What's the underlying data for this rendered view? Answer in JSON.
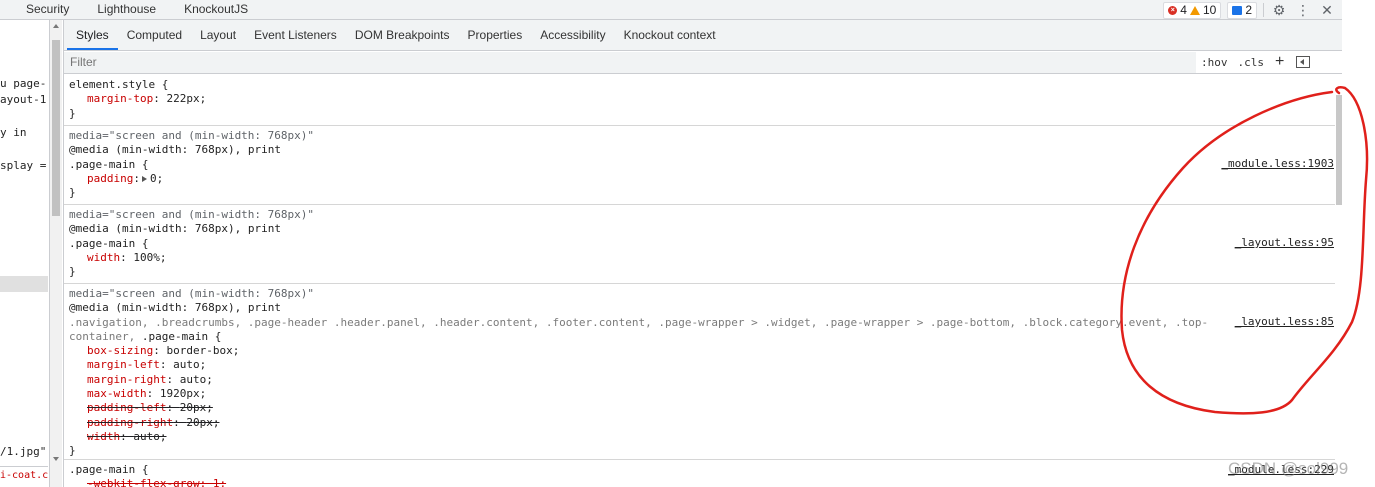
{
  "topbar": {
    "tabs": [
      "Security",
      "Lighthouse",
      "KnockoutJS"
    ],
    "errors": "4",
    "warnings": "10",
    "messages": "2",
    "icons": [
      "settings-icon",
      "more-vertical-icon",
      "close-icon"
    ],
    "close_glyph": "✕"
  },
  "left_panel": {
    "lines": [
      "u page-",
      "ayout-1",
      "y in",
      "splay ="
    ],
    "bottom_line": "/1.jpg\"",
    "bottom_file": "i-coat.c"
  },
  "styles_panel": {
    "tabs": [
      "Styles",
      "Computed",
      "Layout",
      "Event Listeners",
      "DOM Breakpoints",
      "Properties",
      "Accessibility",
      "Knockout context"
    ],
    "active_tab": "Styles",
    "filter_placeholder": "Filter",
    "hov": ":hov",
    "cls": ".cls",
    "plus": "+"
  },
  "rules": {
    "r0": {
      "selector": "element.style {",
      "decls": [
        {
          "prop": "margin-top",
          "val": "222px;"
        }
      ],
      "close": "}"
    },
    "r1": {
      "media_comment": "media=\"screen and (min-width: 768px)\"",
      "at_keyword": "@media",
      "at_query": " (min-width: 768px), print",
      "selector": ".page-main {",
      "source": "_module.less:1903",
      "decls": [
        {
          "prop": "padding",
          "val": "0;"
        }
      ],
      "close": "}"
    },
    "r2": {
      "media_comment": "media=\"screen and (min-width: 768px)\"",
      "at_keyword": "@media",
      "at_query": " (min-width: 768px), print",
      "selector": ".page-main {",
      "source": "_layout.less:95",
      "decls": [
        {
          "prop": "width",
          "val": "100%;"
        }
      ],
      "close": "}"
    },
    "r3": {
      "media_comment": "media=\"screen and (min-width: 768px)\"",
      "at_keyword": "@media",
      "at_query": " (min-width: 768px), print",
      "selector_dim": ".navigation, .breadcrumbs, .page-header .header.panel, .header.content, .footer.content, .page-wrapper > .widget, .page-wrapper > .page-bottom, .block.category.event, .top-container, ",
      "selector": ".page-main {",
      "source": "_layout.less:85",
      "decls": [
        {
          "prop": "box-sizing",
          "val": "border-box;"
        },
        {
          "prop": "margin-left",
          "val": "auto;"
        },
        {
          "prop": "margin-right",
          "val": "auto;"
        },
        {
          "prop": "max-width",
          "val": "1920px;"
        },
        {
          "prop": "padding-left",
          "val": "20px;"
        },
        {
          "prop": "padding-right",
          "val": "20px;"
        },
        {
          "prop": "width",
          "val": "auto;"
        }
      ],
      "close": "}"
    },
    "r4": {
      "selector": ".page-main {",
      "source": "_module.less:229",
      "decl_partial": "-webkit-flex-grow: 1;"
    }
  },
  "annotation": {
    "color": "#e0201b",
    "shape": "red-freehand-circle-around-source-links"
  },
  "watermark": "CSDN @sol999"
}
